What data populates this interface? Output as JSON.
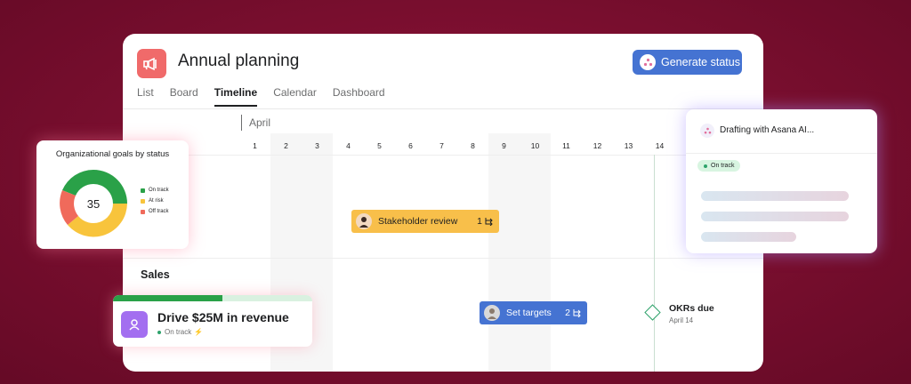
{
  "project": {
    "title": "Annual planning",
    "icon": "megaphone-icon",
    "color": "#f06a6a"
  },
  "header": {
    "generate_button_label": "Generate status",
    "generate_icon": "sparkle-icon",
    "accent": "#4573d2"
  },
  "tabs": [
    {
      "label": "List",
      "active": false
    },
    {
      "label": "Board",
      "active": false
    },
    {
      "label": "Timeline",
      "active": true
    },
    {
      "label": "Calendar",
      "active": false
    },
    {
      "label": "Dashboard",
      "active": false
    }
  ],
  "timeline": {
    "month": "April",
    "days": [
      "1",
      "2",
      "3",
      "4",
      "5",
      "6",
      "7",
      "8",
      "9",
      "10",
      "11",
      "12",
      "13",
      "14"
    ],
    "sections": [
      {
        "name": "Sales"
      }
    ],
    "tasks": [
      {
        "label": "Stakeholder review",
        "count": "1",
        "color": "#f8bf4a"
      },
      {
        "label": "Set targets",
        "count": "2",
        "color": "#4573d2"
      }
    ],
    "milestone": {
      "title": "OKRs due",
      "date": "April 14",
      "color": "#2ea26b"
    }
  },
  "goals_widget": {
    "title": "Organizational goals by status",
    "center_value": "35",
    "legend": [
      {
        "label": "On track",
        "color": "#2aa148"
      },
      {
        "label": "At risk",
        "color": "#f8c43c"
      },
      {
        "label": "Off track",
        "color": "#f06a5b"
      }
    ]
  },
  "ai_card": {
    "title": "Drafting with Asana AI...",
    "status": "On track",
    "icon": "sparkle-icon"
  },
  "goal_card": {
    "title": "Drive $25M in revenue",
    "status": "On track",
    "progress_percent": 55,
    "icon": "person-icon",
    "status_icon": "lightning-icon"
  }
}
